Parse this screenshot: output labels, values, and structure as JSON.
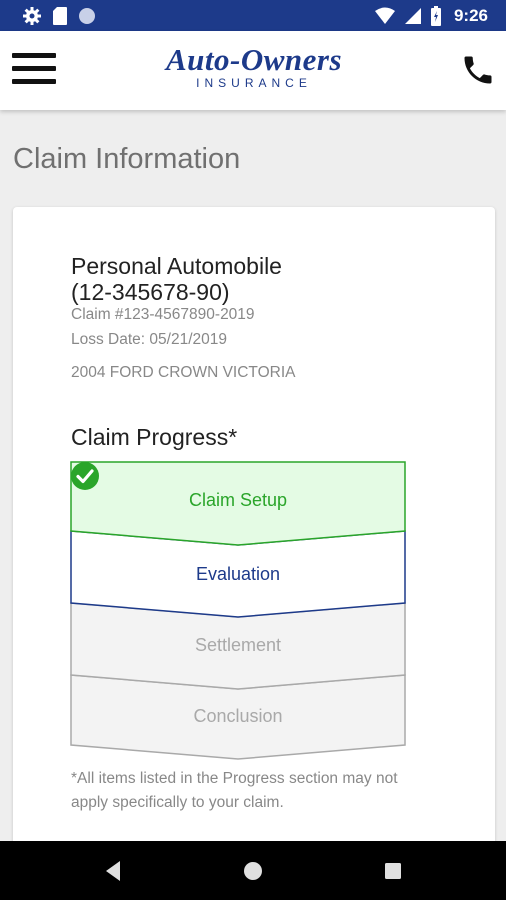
{
  "status_bar": {
    "time": "9:26",
    "left_icons": [
      "gear-icon",
      "sd-card-icon",
      "circle-icon"
    ],
    "right_icons": [
      "wifi-icon",
      "cell-signal-icon",
      "battery-icon"
    ]
  },
  "app_bar": {
    "logo_brand": "Auto-Owners",
    "logo_sub": "INSURANCE",
    "brand_color": "#1d3a8a"
  },
  "page": {
    "title": "Claim Information"
  },
  "claim": {
    "policy_name": "Personal Automobile",
    "policy_number": "(12-345678-90)",
    "claim_number": "Claim #123-4567890-2019",
    "loss_date": "Loss Date: 05/21/2019",
    "vehicle": "2004 FORD CROWN VICTORIA"
  },
  "progress": {
    "title": "Claim Progress*",
    "steps": [
      {
        "label": "Claim Setup",
        "state": "complete",
        "color": "#2aa52a"
      },
      {
        "label": "Evaluation",
        "state": "current",
        "color": "#1d3a8a"
      },
      {
        "label": "Settlement",
        "state": "pending",
        "color": "#a9a9a9"
      },
      {
        "label": "Conclusion",
        "state": "pending",
        "color": "#a9a9a9"
      }
    ],
    "footnote": "*All items listed in the Progress section may not apply specifically to your claim."
  },
  "nav_bar": {
    "buttons": [
      "back-icon",
      "home-icon",
      "recents-icon"
    ]
  }
}
